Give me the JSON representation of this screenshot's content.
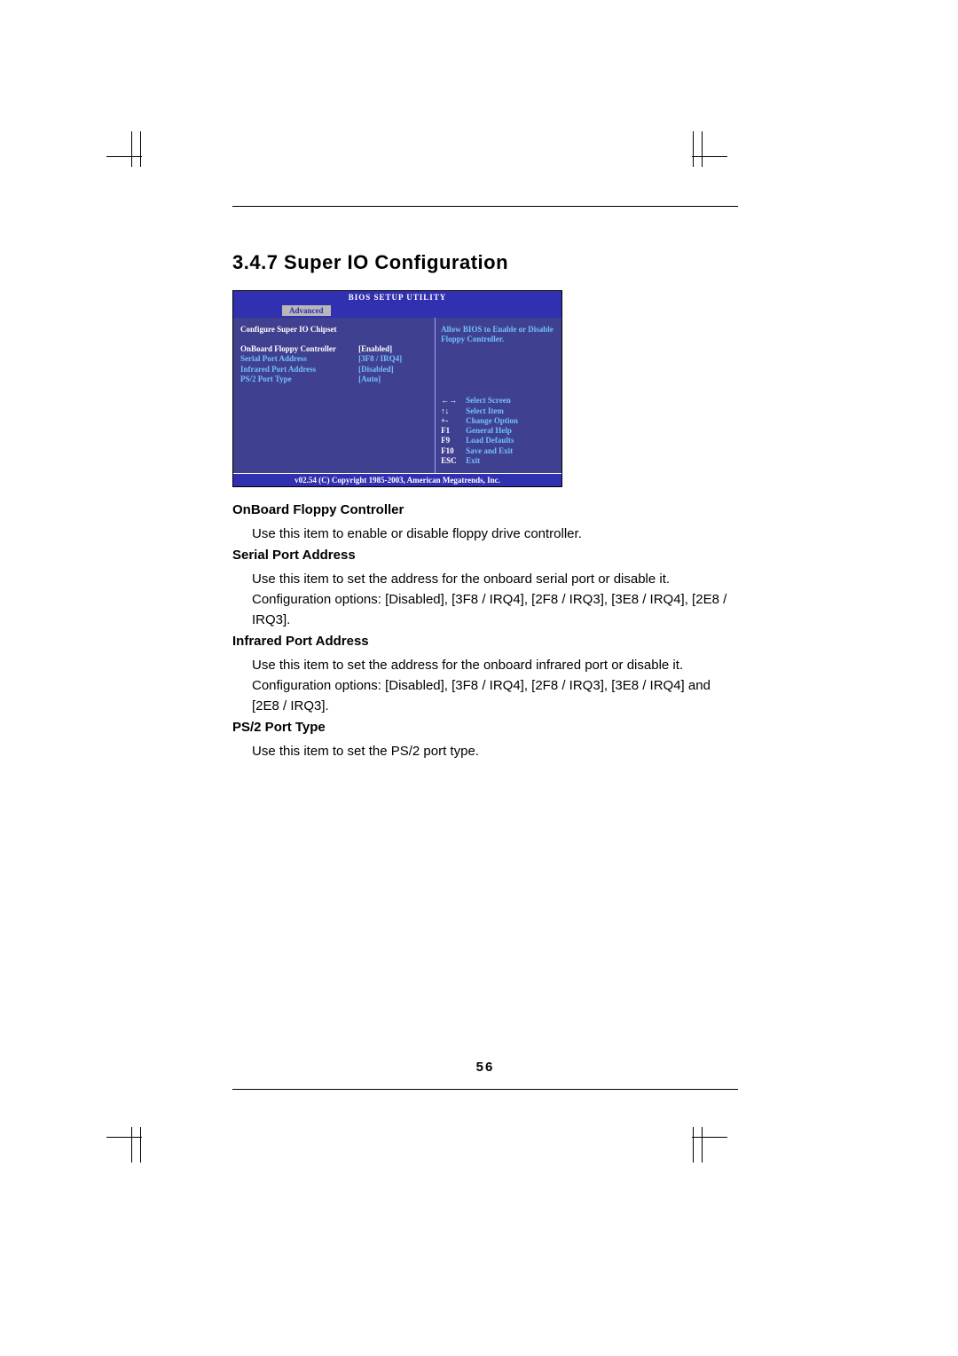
{
  "heading": "3.4.7 Super IO Configuration",
  "bios": {
    "title": "BIOS SETUP UTILITY",
    "tab": "Advanced",
    "section_title": "Configure Super IO Chipset",
    "rows": [
      {
        "label": "OnBoard Floppy Controller",
        "value": "[Enabled]",
        "selected": true
      },
      {
        "label": "Serial Port Address",
        "value": "[3F8 / IRQ4]",
        "selected": false
      },
      {
        "label": "Infrared Port Address",
        "value": "[Disabled]",
        "selected": false
      },
      {
        "label": "PS/2 Port Type",
        "value": "[Auto]",
        "selected": false
      }
    ],
    "help": "Allow BIOS to Enable or Disable Floppy Controller.",
    "keys": [
      {
        "k": "←→",
        "d": "Select Screen"
      },
      {
        "k": "↑↓",
        "d": "Select Item"
      },
      {
        "k": "+-",
        "d": "Change Option"
      },
      {
        "k": "F1",
        "d": "General Help"
      },
      {
        "k": "F9",
        "d": "Load Defaults"
      },
      {
        "k": "F10",
        "d": "Save and Exit"
      },
      {
        "k": "ESC",
        "d": "Exit"
      }
    ],
    "footer": "v02.54 (C) Copyright 1985-2003, American Megatrends, Inc."
  },
  "descriptions": [
    {
      "title": "OnBoard Floppy Controller",
      "body": "Use this item to enable or disable floppy drive controller."
    },
    {
      "title": "Serial Port Address",
      "body": "Use this item to set the address for the onboard serial port or disable it. Configuration options: [Disabled], [3F8 / IRQ4], [2F8 / IRQ3], [3E8 / IRQ4], [2E8 / IRQ3]."
    },
    {
      "title": "Infrared Port Address",
      "body": "Use this item to set the address for the onboard infrared port or disable it. Configuration options: [Disabled], [3F8 / IRQ4], [2F8 / IRQ3], [3E8 / IRQ4] and [2E8 / IRQ3]."
    },
    {
      "title": "PS/2 Port Type",
      "body": "Use this item to set the PS/2 port type."
    }
  ],
  "page_number": "56"
}
